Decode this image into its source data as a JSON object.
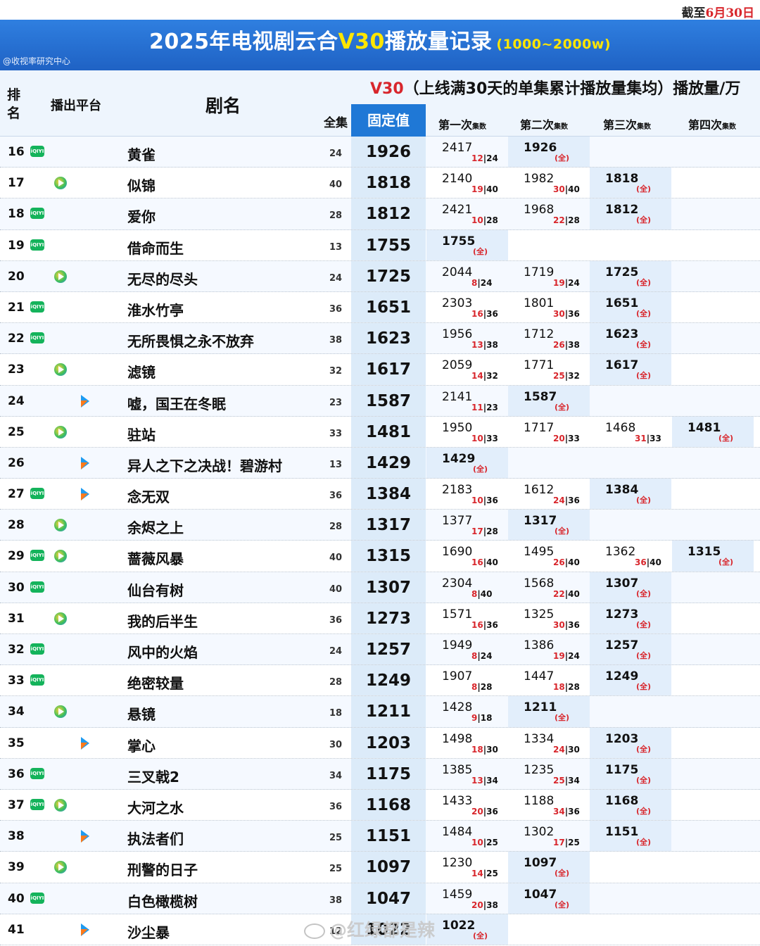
{
  "date_note": {
    "prefix": "截至",
    "date": "6月30日"
  },
  "banner": {
    "title_prefix": "2025年电视剧云合",
    "title_v30": "V30",
    "title_suffix": "播放量记录",
    "range": "(1000~2000w)",
    "credit": "@收视率研究中心"
  },
  "header": {
    "rank": "排名",
    "platform": "播出平台",
    "name": "剧名",
    "total": "全集",
    "v30_label": "V30",
    "v30_desc": "（上线满30天的单集累计播放量集均）",
    "unit": "播放量/万",
    "fixed": "固定值",
    "attempts": [
      {
        "label": "第一次",
        "sub": "集数"
      },
      {
        "label": "第二次",
        "sub": "集数"
      },
      {
        "label": "第三次",
        "sub": "集数"
      },
      {
        "label": "第四次",
        "sub": "集数"
      }
    ]
  },
  "final_mark": "(全)",
  "rows": [
    {
      "rank": "16",
      "platforms": [
        "iqiyi"
      ],
      "name": "黄雀",
      "total": "24",
      "fixed": "1926",
      "attempts": [
        {
          "v": "2417",
          "ep": "12",
          "of": "24"
        },
        {
          "v": "1926",
          "final": true
        }
      ]
    },
    {
      "rank": "17",
      "platforms": [
        "tencent"
      ],
      "name": "似锦",
      "total": "40",
      "fixed": "1818",
      "attempts": [
        {
          "v": "2140",
          "ep": "19",
          "of": "40"
        },
        {
          "v": "1982",
          "ep": "30",
          "of": "40"
        },
        {
          "v": "1818",
          "final": true
        }
      ]
    },
    {
      "rank": "18",
      "platforms": [
        "iqiyi"
      ],
      "name": "爱你",
      "total": "28",
      "fixed": "1812",
      "attempts": [
        {
          "v": "2421",
          "ep": "10",
          "of": "28"
        },
        {
          "v": "1968",
          "ep": "22",
          "of": "28"
        },
        {
          "v": "1812",
          "final": true
        }
      ]
    },
    {
      "rank": "19",
      "platforms": [
        "iqiyi"
      ],
      "name": "借命而生",
      "total": "13",
      "fixed": "1755",
      "attempts": [
        {
          "v": "1755",
          "final": true
        }
      ]
    },
    {
      "rank": "20",
      "platforms": [
        "tencent"
      ],
      "name": "无尽的尽头",
      "total": "24",
      "fixed": "1725",
      "attempts": [
        {
          "v": "2044",
          "ep": "8",
          "of": "24"
        },
        {
          "v": "1719",
          "ep": "19",
          "of": "24"
        },
        {
          "v": "1725",
          "final": true
        }
      ]
    },
    {
      "rank": "21",
      "platforms": [
        "iqiyi"
      ],
      "name": "淮水竹亭",
      "total": "36",
      "fixed": "1651",
      "attempts": [
        {
          "v": "2303",
          "ep": "16",
          "of": "36"
        },
        {
          "v": "1801",
          "ep": "30",
          "of": "36"
        },
        {
          "v": "1651",
          "final": true
        }
      ]
    },
    {
      "rank": "22",
      "platforms": [
        "iqiyi"
      ],
      "name": "无所畏惧之永不放弃",
      "total": "38",
      "fixed": "1623",
      "attempts": [
        {
          "v": "1956",
          "ep": "13",
          "of": "38"
        },
        {
          "v": "1712",
          "ep": "26",
          "of": "38"
        },
        {
          "v": "1623",
          "final": true
        }
      ]
    },
    {
      "rank": "23",
      "platforms": [
        "tencent"
      ],
      "name": "滤镜",
      "total": "32",
      "fixed": "1617",
      "attempts": [
        {
          "v": "2059",
          "ep": "14",
          "of": "32"
        },
        {
          "v": "1771",
          "ep": "25",
          "of": "32"
        },
        {
          "v": "1617",
          "final": true
        }
      ]
    },
    {
      "rank": "24",
      "platforms": [
        "youku"
      ],
      "name": "嘘，国王在冬眠",
      "total": "23",
      "fixed": "1587",
      "attempts": [
        {
          "v": "2141",
          "ep": "11",
          "of": "23"
        },
        {
          "v": "1587",
          "final": true
        }
      ]
    },
    {
      "rank": "25",
      "platforms": [
        "tencent"
      ],
      "name": "驻站",
      "total": "33",
      "fixed": "1481",
      "attempts": [
        {
          "v": "1950",
          "ep": "10",
          "of": "33"
        },
        {
          "v": "1717",
          "ep": "20",
          "of": "33"
        },
        {
          "v": "1468",
          "ep": "31",
          "of": "33"
        },
        {
          "v": "1481",
          "final": true
        }
      ]
    },
    {
      "rank": "26",
      "platforms": [
        "youku"
      ],
      "name": "异人之下之决战！碧游村",
      "total": "13",
      "fixed": "1429",
      "attempts": [
        {
          "v": "1429",
          "final": true
        }
      ]
    },
    {
      "rank": "27",
      "platforms": [
        "iqiyi",
        "youku"
      ],
      "name": "念无双",
      "total": "36",
      "fixed": "1384",
      "attempts": [
        {
          "v": "2183",
          "ep": "10",
          "of": "36"
        },
        {
          "v": "1612",
          "ep": "24",
          "of": "36"
        },
        {
          "v": "1384",
          "final": true
        }
      ]
    },
    {
      "rank": "28",
      "platforms": [
        "tencent"
      ],
      "name": "余烬之上",
      "total": "28",
      "fixed": "1317",
      "attempts": [
        {
          "v": "1377",
          "ep": "17",
          "of": "28"
        },
        {
          "v": "1317",
          "final": true
        }
      ]
    },
    {
      "rank": "29",
      "platforms": [
        "iqiyi",
        "tencent"
      ],
      "name": "蔷薇风暴",
      "total": "40",
      "fixed": "1315",
      "attempts": [
        {
          "v": "1690",
          "ep": "16",
          "of": "40"
        },
        {
          "v": "1495",
          "ep": "26",
          "of": "40"
        },
        {
          "v": "1362",
          "ep": "36",
          "of": "40"
        },
        {
          "v": "1315",
          "final": true
        }
      ]
    },
    {
      "rank": "30",
      "platforms": [
        "iqiyi"
      ],
      "name": "仙台有树",
      "total": "40",
      "fixed": "1307",
      "attempts": [
        {
          "v": "2304",
          "ep": "8",
          "of": "40"
        },
        {
          "v": "1568",
          "ep": "22",
          "of": "40"
        },
        {
          "v": "1307",
          "final": true
        }
      ]
    },
    {
      "rank": "31",
      "platforms": [
        "tencent"
      ],
      "name": "我的后半生",
      "total": "36",
      "fixed": "1273",
      "attempts": [
        {
          "v": "1571",
          "ep": "16",
          "of": "36"
        },
        {
          "v": "1325",
          "ep": "30",
          "of": "36"
        },
        {
          "v": "1273",
          "final": true
        }
      ]
    },
    {
      "rank": "32",
      "platforms": [
        "iqiyi"
      ],
      "name": "风中的火焰",
      "total": "24",
      "fixed": "1257",
      "attempts": [
        {
          "v": "1949",
          "ep": "8",
          "of": "24"
        },
        {
          "v": "1386",
          "ep": "19",
          "of": "24"
        },
        {
          "v": "1257",
          "final": true
        }
      ]
    },
    {
      "rank": "33",
      "platforms": [
        "iqiyi"
      ],
      "name": "绝密较量",
      "total": "28",
      "fixed": "1249",
      "attempts": [
        {
          "v": "1907",
          "ep": "8",
          "of": "28"
        },
        {
          "v": "1447",
          "ep": "18",
          "of": "28"
        },
        {
          "v": "1249",
          "final": true
        }
      ]
    },
    {
      "rank": "34",
      "platforms": [
        "tencent"
      ],
      "name": "悬镜",
      "total": "18",
      "fixed": "1211",
      "attempts": [
        {
          "v": "1428",
          "ep": "9",
          "of": "18"
        },
        {
          "v": "1211",
          "final": true
        }
      ]
    },
    {
      "rank": "35",
      "platforms": [
        "youku"
      ],
      "name": "掌心",
      "total": "30",
      "fixed": "1203",
      "attempts": [
        {
          "v": "1498",
          "ep": "18",
          "of": "30"
        },
        {
          "v": "1334",
          "ep": "24",
          "of": "30"
        },
        {
          "v": "1203",
          "final": true
        }
      ]
    },
    {
      "rank": "36",
      "platforms": [
        "iqiyi"
      ],
      "name": "三叉戟2",
      "total": "34",
      "fixed": "1175",
      "attempts": [
        {
          "v": "1385",
          "ep": "13",
          "of": "34"
        },
        {
          "v": "1235",
          "ep": "25",
          "of": "34"
        },
        {
          "v": "1175",
          "final": true
        }
      ]
    },
    {
      "rank": "37",
      "platforms": [
        "iqiyi",
        "tencent"
      ],
      "name": "大河之水",
      "total": "36",
      "fixed": "1168",
      "attempts": [
        {
          "v": "1433",
          "ep": "20",
          "of": "36"
        },
        {
          "v": "1188",
          "ep": "34",
          "of": "36"
        },
        {
          "v": "1168",
          "final": true
        }
      ]
    },
    {
      "rank": "38",
      "platforms": [
        "youku"
      ],
      "name": "执法者们",
      "total": "25",
      "fixed": "1151",
      "attempts": [
        {
          "v": "1484",
          "ep": "10",
          "of": "25"
        },
        {
          "v": "1302",
          "ep": "17",
          "of": "25"
        },
        {
          "v": "1151",
          "final": true
        }
      ]
    },
    {
      "rank": "39",
      "platforms": [
        "tencent"
      ],
      "name": "刑警的日子",
      "total": "25",
      "fixed": "1097",
      "attempts": [
        {
          "v": "1230",
          "ep": "14",
          "of": "25"
        },
        {
          "v": "1097",
          "final": true
        }
      ]
    },
    {
      "rank": "40",
      "platforms": [
        "iqiyi"
      ],
      "name": "白色橄榄树",
      "total": "38",
      "fixed": "1047",
      "attempts": [
        {
          "v": "1459",
          "ep": "20",
          "of": "38"
        },
        {
          "v": "1047",
          "final": true
        }
      ]
    },
    {
      "rank": "41",
      "platforms": [
        "youku"
      ],
      "name": "沙尘暴",
      "total": "12",
      "fixed": "1022",
      "attempts": [
        {
          "v": "1022",
          "final": true
        }
      ]
    }
  ],
  "platform_icons": {
    "iqiyi": "iqiyi-logo-icon",
    "tencent": "tencent-video-logo-icon",
    "youku": "youku-logo-icon"
  },
  "watermark": "红绿都是辣",
  "colors": {
    "banner": "#1f62c4",
    "accent_red": "#d8262c",
    "fixed_header": "#1f78d6",
    "fixed_cell": "#dcebf9",
    "iqiyi": "#14b35b"
  }
}
